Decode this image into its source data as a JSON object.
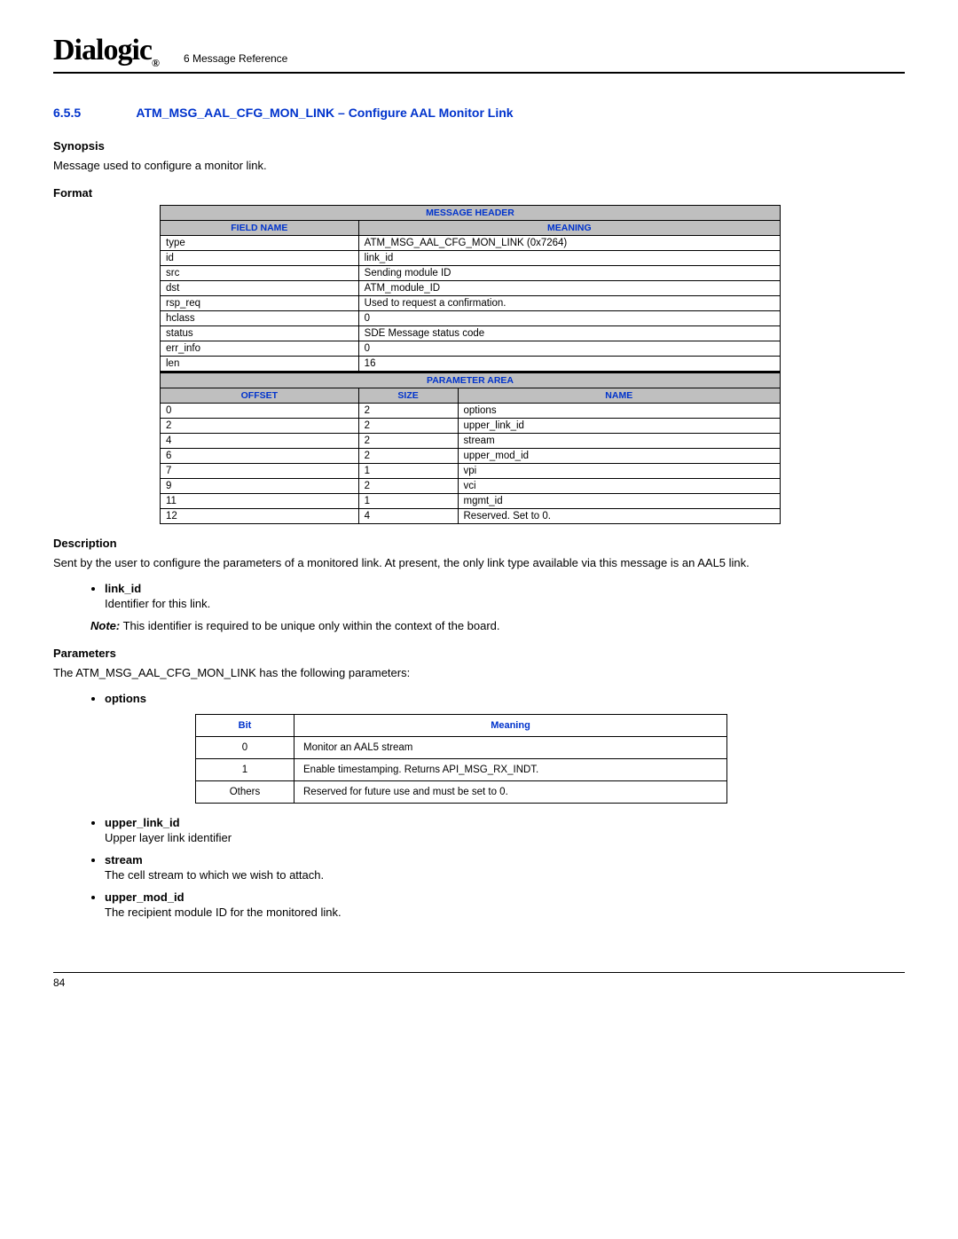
{
  "header": {
    "logo": "Dialogic",
    "chapter": "6 Message Reference"
  },
  "section": {
    "number": "6.5.5",
    "title": "ATM_MSG_AAL_CFG_MON_LINK – Configure AAL Monitor Link"
  },
  "synopsis": {
    "label": "Synopsis",
    "text": "Message used to configure a monitor link."
  },
  "format": {
    "label": "Format",
    "message_header_label": "MESSAGE HEADER",
    "field_name_label": "FIELD NAME",
    "meaning_label": "MEANING",
    "header_rows": [
      {
        "field": "type",
        "meaning": "ATM_MSG_AAL_CFG_MON_LINK (0x7264)"
      },
      {
        "field": "id",
        "meaning": "link_id"
      },
      {
        "field": "src",
        "meaning": "Sending module ID"
      },
      {
        "field": "dst",
        "meaning": "ATM_module_ID"
      },
      {
        "field": "rsp_req",
        "meaning": "Used to request a confirmation."
      },
      {
        "field": "hclass",
        "meaning": "0"
      },
      {
        "field": "status",
        "meaning": "SDE Message status code"
      },
      {
        "field": "err_info",
        "meaning": "0"
      },
      {
        "field": "len",
        "meaning": "16"
      }
    ],
    "parameter_area_label": "PARAMETER AREA",
    "offset_label": "OFFSET",
    "size_label": "SIZE",
    "name_label": "NAME",
    "param_rows": [
      {
        "offset": "0",
        "size": "2",
        "name": "options"
      },
      {
        "offset": "2",
        "size": "2",
        "name": "upper_link_id"
      },
      {
        "offset": "4",
        "size": "2",
        "name": "stream"
      },
      {
        "offset": "6",
        "size": "2",
        "name": "upper_mod_id"
      },
      {
        "offset": "7",
        "size": "1",
        "name": "vpi"
      },
      {
        "offset": "9",
        "size": "2",
        "name": "vci"
      },
      {
        "offset": "11",
        "size": "1",
        "name": "mgmt_id"
      },
      {
        "offset": "12",
        "size": "4",
        "name": "Reserved. Set to 0."
      }
    ]
  },
  "description": {
    "label": "Description",
    "text": "Sent by the user to configure the parameters of a monitored link. At present, the only link type available via this message is an AAL5 link.",
    "link_id": {
      "name": "link_id",
      "desc": "Identifier for this link."
    },
    "note_label": "Note:",
    "note_text": "This identifier is required to be unique only within the context of the board."
  },
  "parameters": {
    "label": "Parameters",
    "intro": "The ATM_MSG_AAL_CFG_MON_LINK has the following parameters:",
    "options_name": "options",
    "options_table": {
      "bit_label": "Bit",
      "meaning_label": "Meaning",
      "rows": [
        {
          "bit": "0",
          "meaning": "Monitor an AAL5 stream"
        },
        {
          "bit": "1",
          "meaning": "Enable timestamping. Returns API_MSG_RX_INDT."
        },
        {
          "bit": "Others",
          "meaning": "Reserved for future use and must be set to 0."
        }
      ]
    },
    "list": [
      {
        "name": "upper_link_id",
        "desc": "Upper layer link identifier"
      },
      {
        "name": "stream",
        "desc": "The cell stream to which we wish to attach."
      },
      {
        "name": "upper_mod_id",
        "desc": "The recipient module ID for the monitored link."
      }
    ]
  },
  "footer": {
    "page": "84"
  }
}
